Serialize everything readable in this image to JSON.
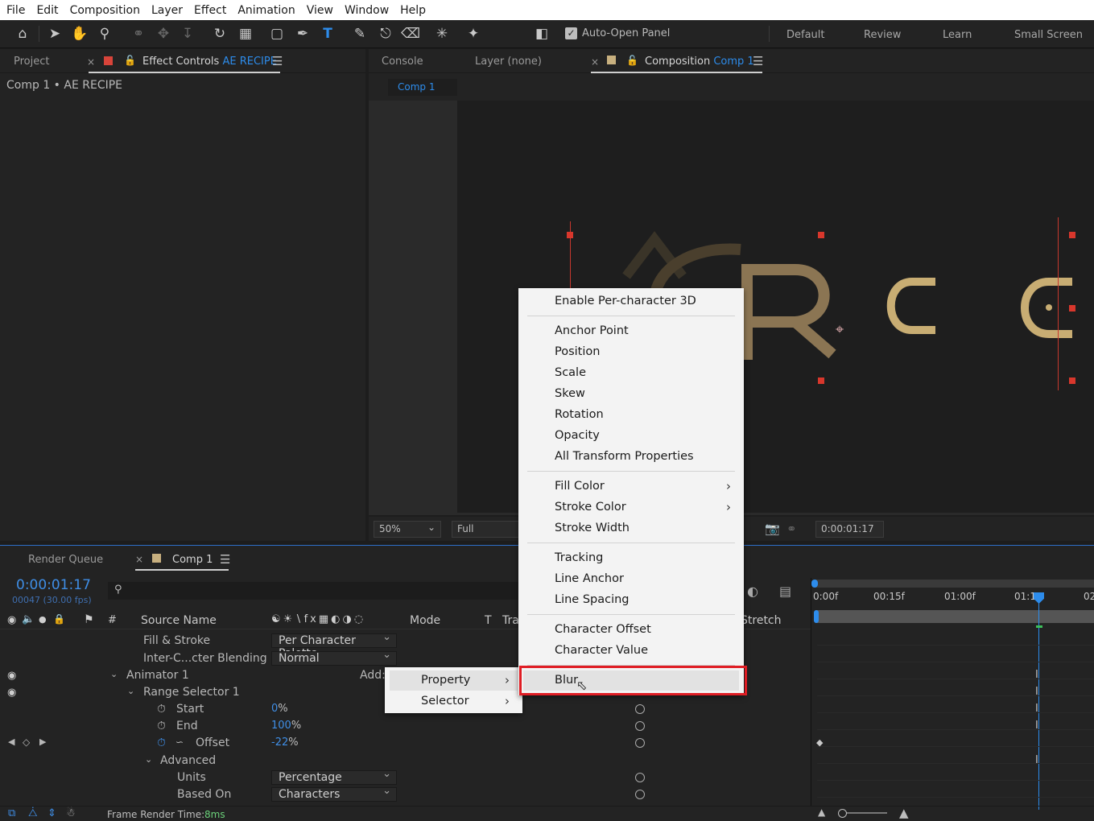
{
  "menubar": [
    "File",
    "Edit",
    "Composition",
    "Layer",
    "Effect",
    "Animation",
    "View",
    "Window",
    "Help"
  ],
  "toolbar": {
    "auto_open_label": "Auto-Open Panel",
    "auto_open_checked": true,
    "workspaces": [
      "Default",
      "Review",
      "Learn",
      "Small Screen"
    ]
  },
  "left_panel": {
    "tab_project": "Project",
    "tab_effect_controls": "Effect Controls",
    "tab_effect_controls_target": "AE RECIPE",
    "subtitle": "Comp 1 • AE RECIPE"
  },
  "comp_panel": {
    "tab_console": "Console",
    "tab_layer": "Layer (none)",
    "tab_composition": "Composition",
    "tab_composition_target": "Comp 1",
    "flow_tab": "Comp 1",
    "zoom": "50%",
    "resolution": "Full",
    "timecode": "0:00:01:17"
  },
  "timeline": {
    "tab_render_queue": "Render Queue",
    "tab_comp": "Comp 1",
    "current_time": "0:00:01:17",
    "frame_info": "00047 (30.00 fps)",
    "search_placeholder": "",
    "col_hash": "#",
    "col_source_name": "Source Name",
    "col_mode": "Mode",
    "col_t": "T",
    "col_track": "Tra",
    "col_stretch": "Stretch",
    "ruler": [
      "0:00f",
      "00:15f",
      "01:00f",
      "01:1",
      "02"
    ],
    "rows": {
      "fill_stroke": {
        "label": "Fill & Stroke",
        "value": "Per Character Palette"
      },
      "inter_char": {
        "label": "Inter-C...cter Blending",
        "value": "Normal"
      },
      "animator": {
        "label": "Animator 1",
        "add_label": "Add:"
      },
      "range_selector": {
        "label": "Range Selector 1"
      },
      "start": {
        "label": "Start",
        "value": "0",
        "unit": "%"
      },
      "end": {
        "label": "End",
        "value": "100",
        "unit": "%"
      },
      "offset": {
        "label": "Offset",
        "value": "-22",
        "unit": "%"
      },
      "advanced": {
        "label": "Advanced"
      },
      "units": {
        "label": "Units",
        "value": "Percentage"
      },
      "based_on": {
        "label": "Based On",
        "value": "Characters"
      }
    },
    "frame_render_label": "Frame Render Time:",
    "frame_render_value": "8ms"
  },
  "add_menu": {
    "items": [
      "Property",
      "Selector"
    ]
  },
  "property_menu": {
    "enable_3d": "Enable Per-character 3D",
    "group_transform": [
      "Anchor Point",
      "Position",
      "Scale",
      "Skew",
      "Rotation",
      "Opacity",
      "All Transform Properties"
    ],
    "group_color": [
      "Fill Color",
      "Stroke Color",
      "Stroke Width"
    ],
    "group_spacing": [
      "Tracking",
      "Line Anchor",
      "Line Spacing"
    ],
    "group_character": [
      "Character Offset",
      "Character Value"
    ],
    "blur": "Blur"
  },
  "colors": {
    "accent_blue": "#2d8ceb",
    "highlight_red": "#e01d24",
    "text_gold": "#c8ad73"
  }
}
